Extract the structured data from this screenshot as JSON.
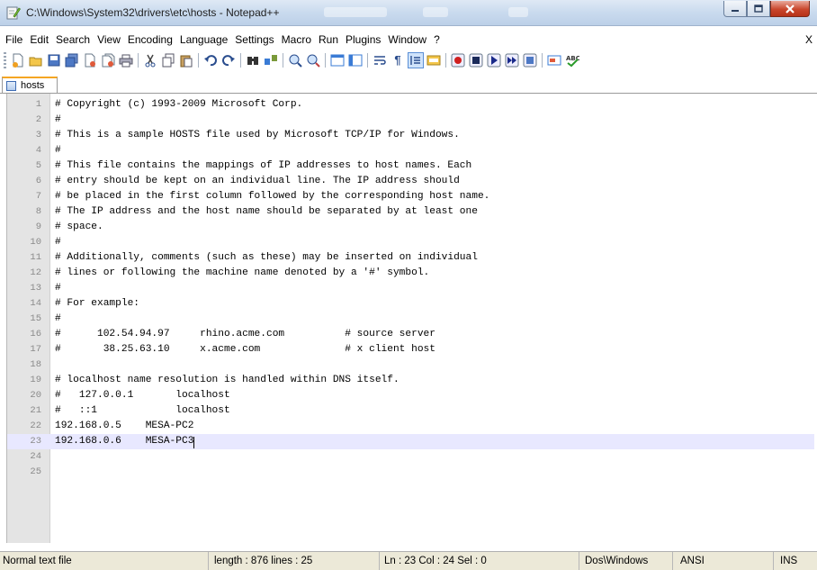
{
  "window": {
    "title": "C:\\Windows\\System32\\drivers\\etc\\hosts - Notepad++"
  },
  "menubar": {
    "items": [
      "File",
      "Edit",
      "Search",
      "View",
      "Encoding",
      "Language",
      "Settings",
      "Macro",
      "Run",
      "Plugins",
      "Window",
      "?"
    ],
    "close_label": "X"
  },
  "toolbar": {
    "buttons": [
      "new-file-icon",
      "open-file-icon",
      "save-icon",
      "save-all-icon",
      "close-icon",
      "close-all-icon",
      "print-icon",
      "cut-icon",
      "copy-icon",
      "paste-icon",
      "undo-icon",
      "redo-icon",
      "find-icon",
      "replace-icon",
      "zoom-in-icon",
      "zoom-out-icon",
      "sync-vertical-icon",
      "sync-horizontal-icon",
      "word-wrap-icon",
      "show-all-chars-icon",
      "indent-guide-icon",
      "user-lang-icon",
      "record-macro-icon",
      "stop-record-icon",
      "play-macro-icon",
      "play-multiple-icon",
      "save-macro-icon",
      "trim-icon",
      "spellcheck-icon"
    ]
  },
  "tabs": [
    {
      "label": "hosts"
    }
  ],
  "editor": {
    "lines": [
      "# Copyright (c) 1993-2009 Microsoft Corp.",
      "#",
      "# This is a sample HOSTS file used by Microsoft TCP/IP for Windows.",
      "#",
      "# This file contains the mappings of IP addresses to host names. Each",
      "# entry should be kept on an individual line. The IP address should",
      "# be placed in the first column followed by the corresponding host name.",
      "# The IP address and the host name should be separated by at least one",
      "# space.",
      "#",
      "# Additionally, comments (such as these) may be inserted on individual",
      "# lines or following the machine name denoted by a '#' symbol.",
      "#",
      "# For example:",
      "#",
      "#      102.54.94.97     rhino.acme.com          # source server",
      "#       38.25.63.10     x.acme.com              # x client host",
      "",
      "# localhost name resolution is handled within DNS itself.",
      "#   127.0.0.1       localhost",
      "#   ::1             localhost",
      "192.168.0.5    MESA-PC2",
      "192.168.0.6    MESA-PC3",
      "",
      ""
    ],
    "current_line": 23
  },
  "statusbar": {
    "file_type": "Normal text file",
    "length": "length : 876   lines : 25",
    "position": "Ln : 23   Col : 24   Sel : 0",
    "eol": "Dos\\Windows",
    "encoding": "ANSI",
    "mode": "INS"
  }
}
